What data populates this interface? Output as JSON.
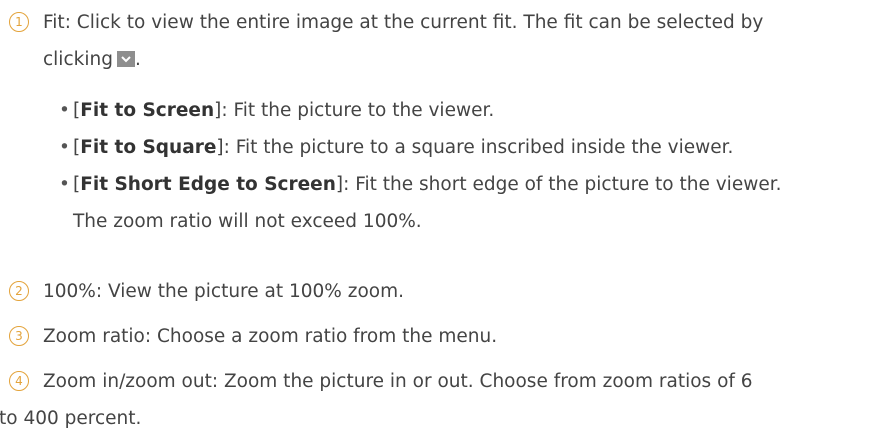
{
  "items": [
    {
      "num": "1",
      "text": "Fit: Click to view the entire image at the current fit. The fit can be selected by",
      "text2": "clicking",
      "text2_end": ".",
      "icon": "chevron-down-icon"
    },
    {
      "num": "2",
      "text": "100%: View the picture at 100% zoom."
    },
    {
      "num": "3",
      "text": "Zoom ratio: Choose a zoom ratio from the menu."
    },
    {
      "num": "4",
      "text": "Zoom in/zoom out: Zoom the picture in or out. Choose from zoom ratios of 6",
      "text2": "to 400 percent."
    }
  ],
  "bullets": [
    {
      "open": "[",
      "label": "Fit to Screen",
      "close": "]",
      "desc": ": Fit the picture to the viewer."
    },
    {
      "open": "[",
      "label": "Fit to Square",
      "close": "]",
      "desc": ": Fit the picture to a square inscribed inside the viewer."
    },
    {
      "open": "[",
      "label": "Fit Short Edge to Screen",
      "close": "]",
      "desc": ": Fit the short edge of the picture to the viewer.",
      "desc2": "The zoom ratio will not exceed 100%."
    }
  ],
  "colors": {
    "accent": "#e3a33b",
    "text": "#444444"
  }
}
